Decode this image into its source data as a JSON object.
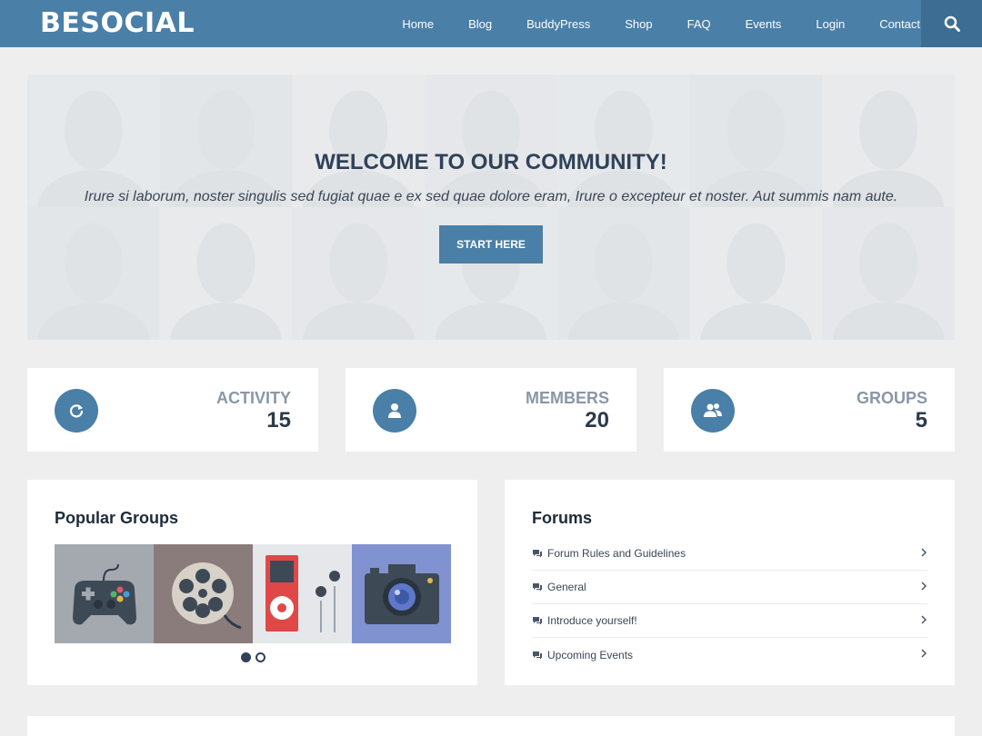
{
  "header": {
    "logo": "BESOCIAL",
    "nav": [
      "Home",
      "Blog",
      "BuddyPress",
      "Shop",
      "FAQ",
      "Events",
      "Login",
      "Contact"
    ],
    "search_icon": "search-icon"
  },
  "hero": {
    "title": "WELCOME TO OUR COMMUNITY!",
    "subtitle": "Irure si laborum, noster singulis sed fugiat quae e ex sed quae dolore eram, Irure o excepteur et noster. Aut summis nam aute.",
    "button": "START HERE"
  },
  "stats": [
    {
      "label": "ACTIVITY",
      "value": "15",
      "icon": "refresh-icon"
    },
    {
      "label": "MEMBERS",
      "value": "20",
      "icon": "user-icon"
    },
    {
      "label": "GROUPS",
      "value": "5",
      "icon": "group-icon"
    }
  ],
  "popular_groups": {
    "title": "Popular Groups",
    "tiles": [
      "gamepad-icon",
      "film-reel-icon",
      "music-player-icon",
      "camera-icon"
    ],
    "slides": 2,
    "active_slide": 1
  },
  "forums": {
    "title": "Forums",
    "items": [
      "Forum Rules and Guidelines",
      "General",
      "Introduce yourself!",
      "Upcoming Events"
    ]
  },
  "colors": {
    "primary": "#4a7fa7",
    "primary_dark": "#3d6d92",
    "background": "#eeeeee",
    "text_dark": "#2d3a4a",
    "text_muted": "#8a97a6"
  }
}
